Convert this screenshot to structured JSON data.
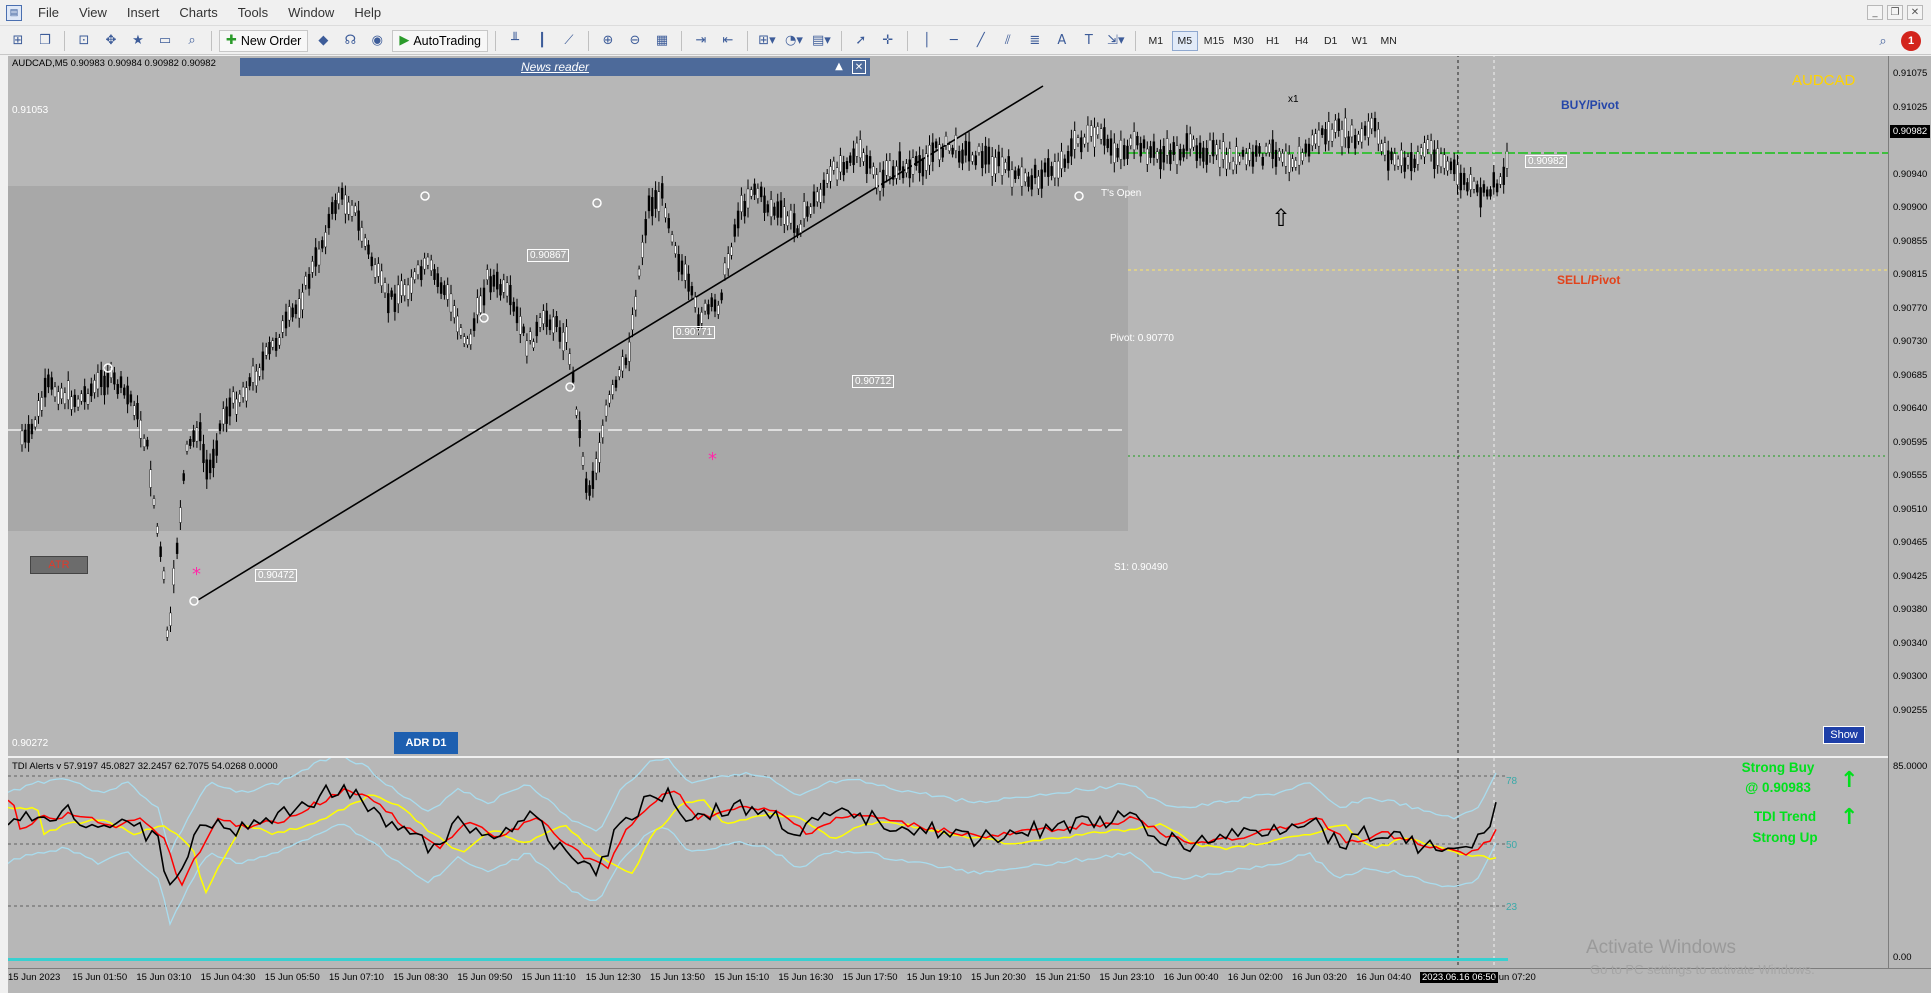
{
  "menubar": {
    "items": [
      "File",
      "View",
      "Insert",
      "Charts",
      "Tools",
      "Window",
      "Help"
    ]
  },
  "toolbar": {
    "new_order": "New Order",
    "auto_trading": "AutoTrading",
    "timeframes": [
      "M1",
      "M5",
      "M15",
      "M30",
      "H1",
      "H4",
      "D1",
      "W1",
      "MN"
    ],
    "active_timeframe": "M5",
    "notifications": "1"
  },
  "chart": {
    "symbol_header": "AUDCAD,M5  0.90983 0.90984 0.90982 0.90982",
    "news_reader": "News reader",
    "symbol": "AUDCAD",
    "buy_pivot": "BUY/Pivot",
    "sell_pivot": "SELL/Pivot",
    "pivot_label": "Pivot: 0.90770",
    "s1_label": "S1: 0.90490",
    "todays_open": "T's Open",
    "range_high": "0.91053",
    "range_low": "0.90272",
    "atr": "ATR",
    "adr": "ADR D1",
    "show": "Show",
    "x1": "x1",
    "price_labels": {
      "p90867": "0.90867",
      "p90771": "0.90771",
      "p90712": "0.90712",
      "p90472": "0.90472",
      "p90982": "0.90982"
    }
  },
  "price_axis": {
    "ticks": [
      "0.91075",
      "0.91025",
      "0.90982",
      "0.90940",
      "0.90900",
      "0.90855",
      "0.90815",
      "0.90770",
      "0.90730",
      "0.90685",
      "0.90640",
      "0.90595",
      "0.90555",
      "0.90510",
      "0.90465",
      "0.90425",
      "0.90380",
      "0.90340",
      "0.90300",
      "0.90255"
    ],
    "current": "0.90982",
    "ind_top": "85.0000",
    "ind_bottom": "0.00"
  },
  "indicator": {
    "title": "TDI Alerts v 57.9197 45.0827 32.2457 62.7075 54.0268 0.0000",
    "levels": [
      "78",
      "50",
      "23"
    ],
    "signal_1": "Strong Buy",
    "signal_1b": "@ 0.90983",
    "signal_2": "TDI Trend",
    "signal_2b": "Strong Up",
    "colors": {
      "rsi": "#000000",
      "signal": "#ff0000",
      "base": "#ffff00",
      "bands": "#add8e6"
    }
  },
  "time_axis": {
    "labels": [
      "15 Jun 2023",
      "15 Jun 01:50",
      "15 Jun 03:10",
      "15 Jun 04:30",
      "15 Jun 05:50",
      "15 Jun 07:10",
      "15 Jun 08:30",
      "15 Jun 09:50",
      "15 Jun 11:10",
      "15 Jun 12:30",
      "15 Jun 13:50",
      "15 Jun 15:10",
      "15 Jun 16:30",
      "15 Jun 17:50",
      "15 Jun 19:10",
      "15 Jun 20:30",
      "15 Jun 21:50",
      "15 Jun 23:10",
      "16 Jun 00:40",
      "16 Jun 02:00",
      "16 Jun 03:20",
      "16 Jun 04:40"
    ],
    "highlight": "2023.06.16 06:50",
    "last": "Jun 07:20"
  },
  "watermark": {
    "line1": "Activate Windows",
    "line2": "Go to PC settings to activate Windows."
  }
}
